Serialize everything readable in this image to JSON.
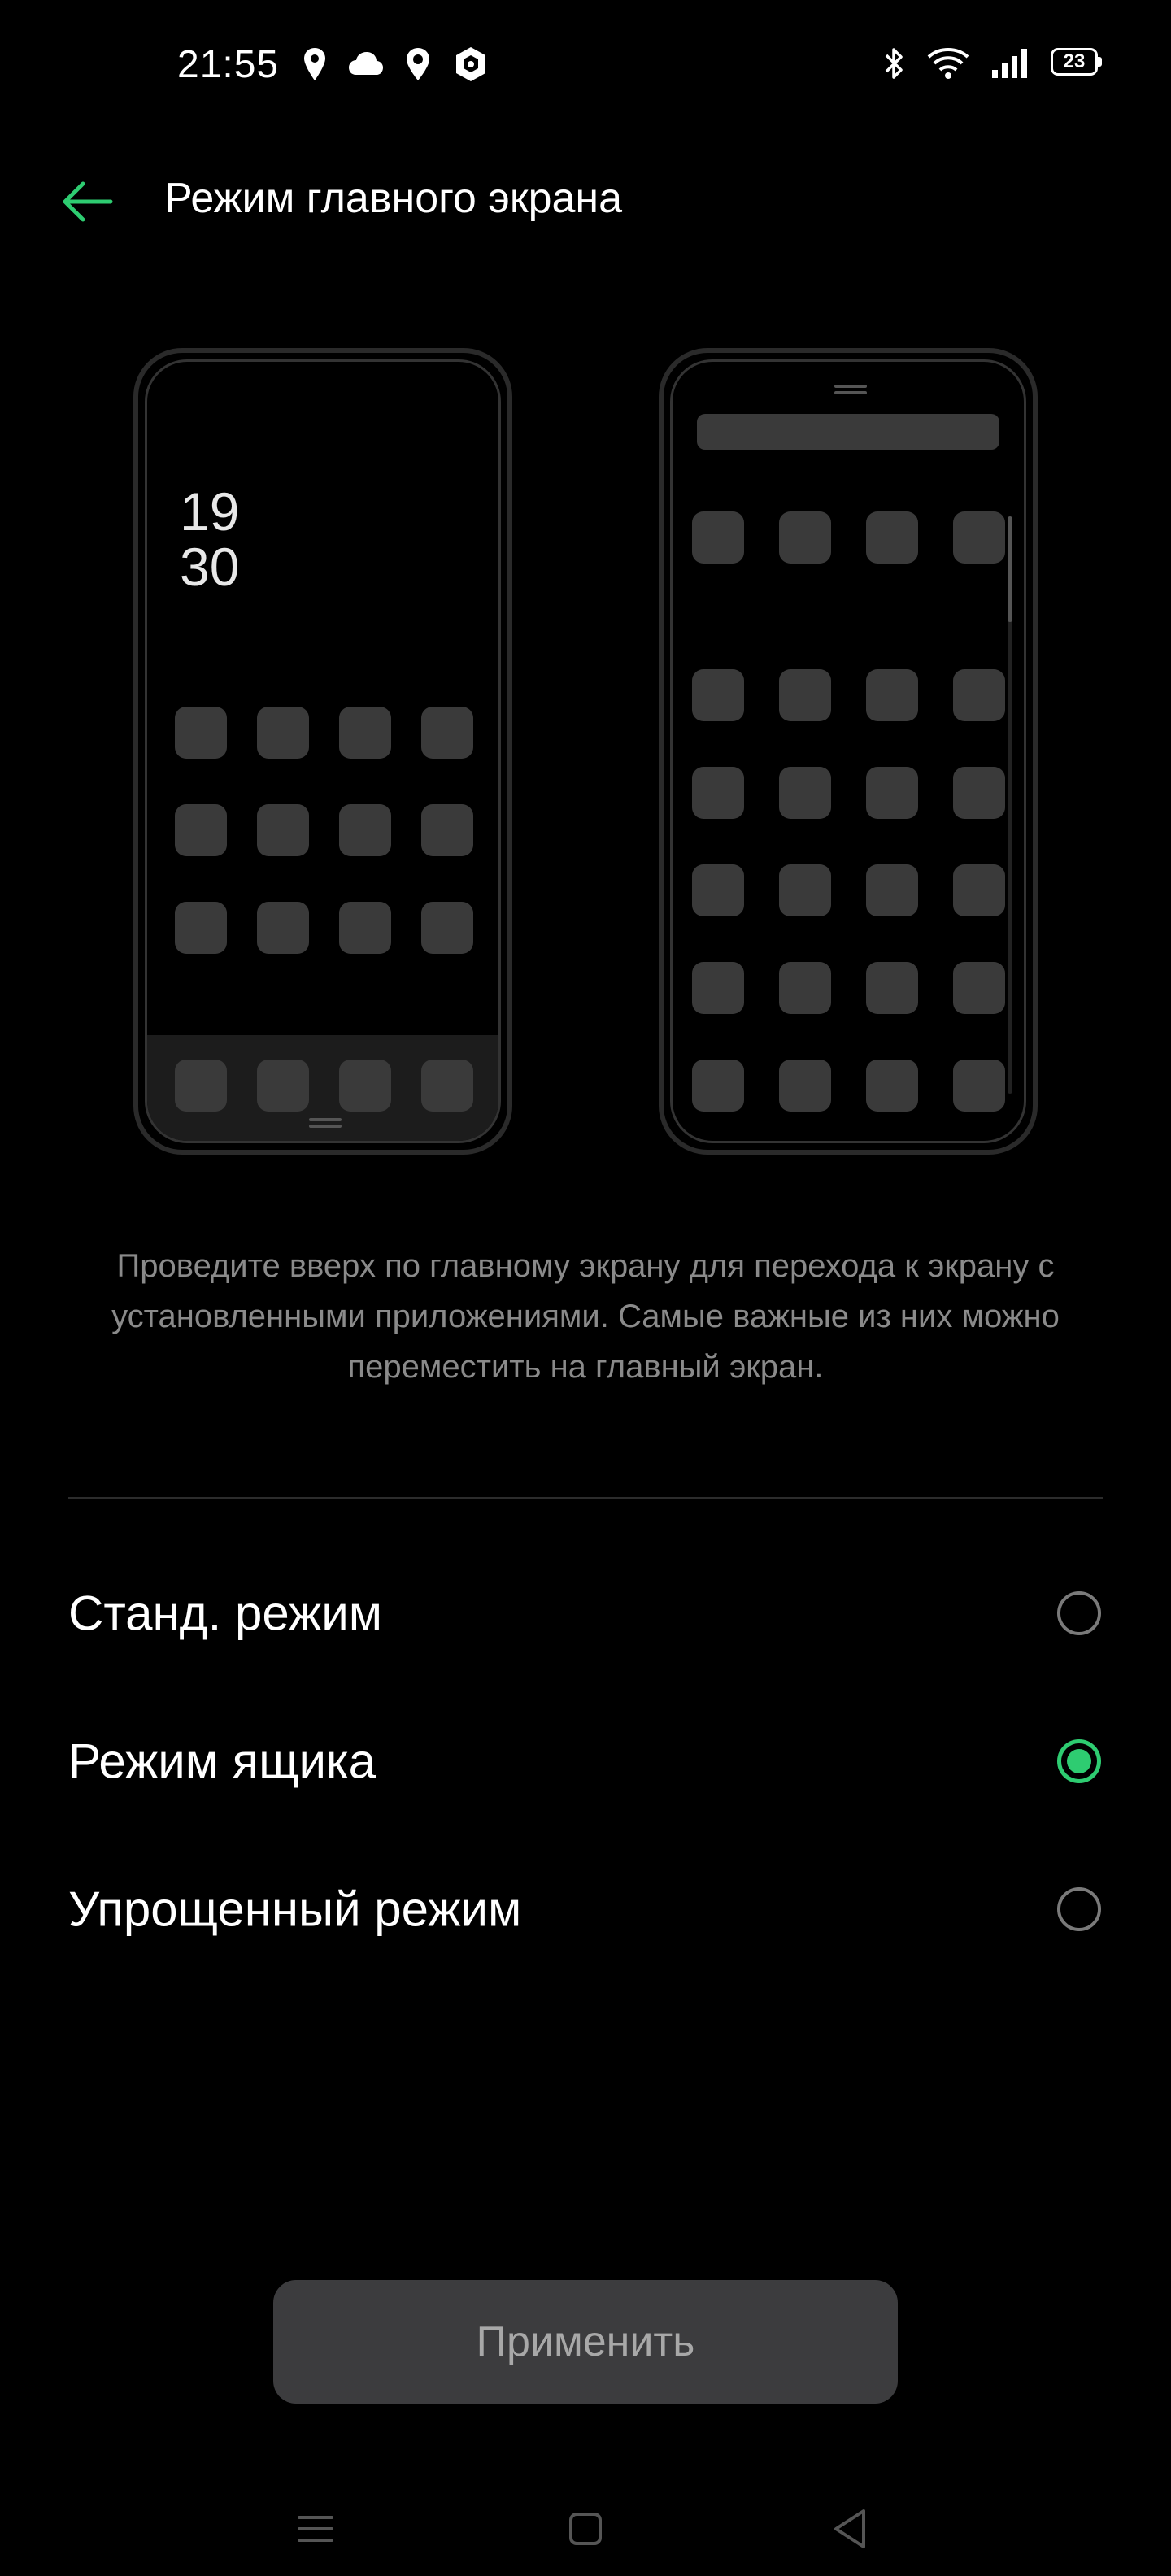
{
  "status_bar": {
    "time": "21:55",
    "battery_level": "23",
    "left_icons": [
      "location-pin-icon",
      "cloud-icon",
      "location-pin-icon",
      "app-notification-icon"
    ],
    "right_icons": [
      "bluetooth-icon",
      "wifi-icon",
      "cellular-signal-icon",
      "battery-icon"
    ]
  },
  "header": {
    "title": "Режим главного экрана",
    "back_icon": "arrow-left-icon"
  },
  "preview_standard": {
    "clock_hour": "19",
    "clock_minute": "30"
  },
  "description": "Проведите вверх по главному экрану для перехода к экрану с установленными приложениями. Самые важные из них можно переместить на главный экран.",
  "options": [
    {
      "label": "Станд. режим",
      "selected": false
    },
    {
      "label": "Режим ящика",
      "selected": true
    },
    {
      "label": "Упрощенный режим",
      "selected": false
    }
  ],
  "apply_button": {
    "label": "Применить"
  },
  "nav_bar": {
    "icons": [
      "menu-icon",
      "home-icon",
      "back-triangle-icon"
    ]
  },
  "colors": {
    "accent": "#2ecc71",
    "background": "#000000",
    "tile": "#3a3a3a",
    "button_bg": "#3c3c3e",
    "description_text": "#8a8a8a"
  }
}
